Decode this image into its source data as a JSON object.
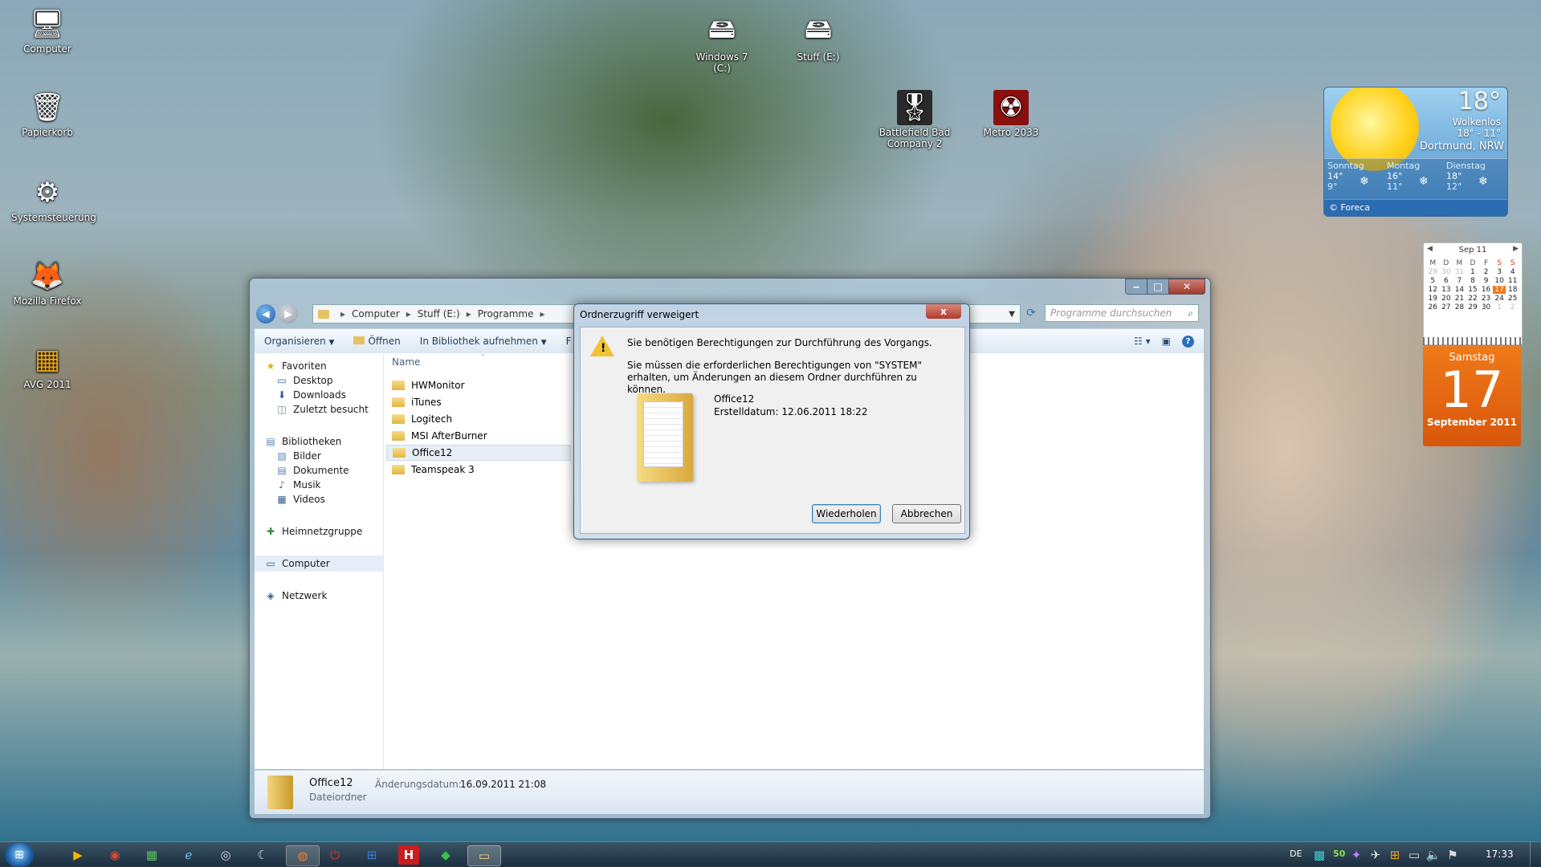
{
  "desktop": {
    "icons_left": [
      {
        "label": "Computer",
        "icon": "computer-icon",
        "glyph": "🖥"
      },
      {
        "label": "Papierkorb",
        "icon": "recycle-bin-icon",
        "glyph": "🗑"
      },
      {
        "label": "Systemsteuerung",
        "icon": "control-panel-icon",
        "glyph": "⚙"
      },
      {
        "label": "Mozilla Firefox",
        "icon": "firefox-icon",
        "glyph": "🦊"
      },
      {
        "label": "AVG 2011",
        "icon": "avg-icon",
        "glyph": "▦"
      }
    ],
    "icons_top": [
      {
        "label": "Windows 7 (C:)",
        "icon": "drive-c-icon",
        "glyph": "🖴"
      },
      {
        "label": "Stuff (E:)",
        "icon": "drive-e-icon",
        "glyph": "🖴"
      },
      {
        "label": "Battlefield Bad Company 2",
        "icon": "battlefield-icon",
        "glyph": "🎖"
      },
      {
        "label": "Metro 2033",
        "icon": "metro-icon",
        "glyph": "☢"
      }
    ]
  },
  "explorer": {
    "address": {
      "segments": [
        "Computer",
        "Stuff (E:)",
        "Programme"
      ]
    },
    "search_placeholder": "Programme durchsuchen",
    "toolbar": {
      "organize": "Organisieren",
      "open": "Öffnen",
      "library": "In Bibliothek aufnehmen",
      "cut": "F"
    },
    "nav": {
      "favorites": "Favoriten",
      "desktop": "Desktop",
      "downloads": "Downloads",
      "recent": "Zuletzt besucht",
      "libraries": "Bibliotheken",
      "pictures": "Bilder",
      "documents": "Dokumente",
      "music": "Musik",
      "videos": "Videos",
      "homegroup": "Heimnetzgruppe",
      "computer": "Computer",
      "network": "Netzwerk"
    },
    "column_name": "Name",
    "files": [
      "HWMonitor",
      "iTunes",
      "Logitech",
      "MSI AfterBurner",
      "Office12",
      "Teamspeak 3"
    ],
    "selected_file": "Office12",
    "details": {
      "name": "Office12",
      "modified_label": "Änderungsdatum:",
      "modified_value": "16.09.2011 21:08",
      "type": "Dateiordner"
    }
  },
  "dialog": {
    "title": "Ordnerzugriff verweigert",
    "message1": "Sie benötigen Berechtigungen zur Durchführung des Vorgangs.",
    "message2": "Sie müssen die erforderlichen Berechtigungen von \"SYSTEM\" erhalten, um Änderungen an diesem Ordner durchführen zu können.",
    "item_name": "Office12",
    "item_created": "Erstelldatum: 12.06.2011 18:22",
    "retry": "Wiederholen",
    "cancel": "Abbrechen",
    "close": "x"
  },
  "weather": {
    "temp": "18°",
    "condition": "Wolkenlos",
    "range": "18° - 11°",
    "location": "Dortmund, NRW",
    "forecast": [
      {
        "day": "Sonntag",
        "high": "14°",
        "low": "9°"
      },
      {
        "day": "Montag",
        "high": "16°",
        "low": "11°"
      },
      {
        "day": "Dienstag",
        "high": "18°",
        "low": "12°"
      }
    ],
    "credit": "© Foreca"
  },
  "calendar": {
    "month": "Sep 11",
    "weekdays": [
      "M",
      "D",
      "M",
      "D",
      "F",
      "S",
      "S"
    ],
    "rows": [
      [
        "29",
        "30",
        "31",
        "1",
        "2",
        "3",
        "4"
      ],
      [
        "5",
        "6",
        "7",
        "8",
        "9",
        "10",
        "11"
      ],
      [
        "12",
        "13",
        "14",
        "15",
        "16",
        "17",
        "18"
      ],
      [
        "19",
        "20",
        "21",
        "22",
        "23",
        "24",
        "25"
      ],
      [
        "26",
        "27",
        "28",
        "29",
        "30",
        "1",
        "2"
      ]
    ],
    "today": "17",
    "weekday_name": "Samstag",
    "day_big": "17",
    "month_year": "September 2011"
  },
  "taskbar": {
    "language": "DE",
    "tray_number": "50",
    "time": "17:33"
  }
}
